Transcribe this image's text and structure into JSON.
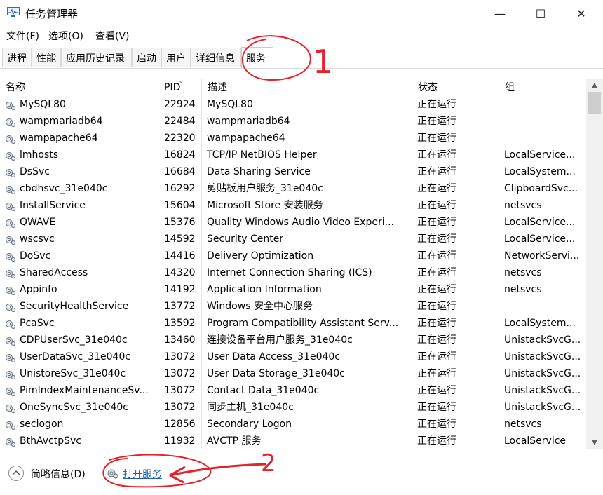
{
  "window": {
    "title": "任务管理器",
    "minimize": "—",
    "maximize": "☐",
    "close": "✕"
  },
  "menu": [
    "文件(F)",
    "选项(O)",
    "查看(V)"
  ],
  "tabs": [
    "进程",
    "性能",
    "应用历史记录",
    "启动",
    "用户",
    "详细信息",
    "服务"
  ],
  "active_tab": "服务",
  "columns": {
    "name": "名称",
    "pid": "PID",
    "desc": "描述",
    "status": "状态",
    "group": "组"
  },
  "rows": [
    {
      "name": "MySQL80",
      "pid": "22924",
      "desc": "MySQL80",
      "status": "正在运行",
      "group": ""
    },
    {
      "name": "wampmariadb64",
      "pid": "22484",
      "desc": "wampmariadb64",
      "status": "正在运行",
      "group": ""
    },
    {
      "name": "wampapache64",
      "pid": "22320",
      "desc": "wampapache64",
      "status": "正在运行",
      "group": ""
    },
    {
      "name": "lmhosts",
      "pid": "16824",
      "desc": "TCP/IP NetBIOS Helper",
      "status": "正在运行",
      "group": "LocalService..."
    },
    {
      "name": "DsSvc",
      "pid": "16684",
      "desc": "Data Sharing Service",
      "status": "正在运行",
      "group": "LocalSystem..."
    },
    {
      "name": "cbdhsvc_31e040c",
      "pid": "16292",
      "desc": "剪贴板用户服务_31e040c",
      "status": "正在运行",
      "group": "ClipboardSvc..."
    },
    {
      "name": "InstallService",
      "pid": "15604",
      "desc": "Microsoft Store 安装服务",
      "status": "正在运行",
      "group": "netsvcs"
    },
    {
      "name": "QWAVE",
      "pid": "15376",
      "desc": "Quality Windows Audio Video Experi...",
      "status": "正在运行",
      "group": "LocalService..."
    },
    {
      "name": "wscsvc",
      "pid": "14592",
      "desc": "Security Center",
      "status": "正在运行",
      "group": "LocalService..."
    },
    {
      "name": "DoSvc",
      "pid": "14416",
      "desc": "Delivery Optimization",
      "status": "正在运行",
      "group": "NetworkServi..."
    },
    {
      "name": "SharedAccess",
      "pid": "14320",
      "desc": "Internet Connection Sharing (ICS)",
      "status": "正在运行",
      "group": "netsvcs"
    },
    {
      "name": "Appinfo",
      "pid": "14192",
      "desc": "Application Information",
      "status": "正在运行",
      "group": "netsvcs"
    },
    {
      "name": "SecurityHealthService",
      "pid": "13772",
      "desc": "Windows 安全中心服务",
      "status": "正在运行",
      "group": ""
    },
    {
      "name": "PcaSvc",
      "pid": "13592",
      "desc": "Program Compatibility Assistant Serv...",
      "status": "正在运行",
      "group": "LocalSystem..."
    },
    {
      "name": "CDPUserSvc_31e040c",
      "pid": "13460",
      "desc": "连接设备平台用户服务_31e040c",
      "status": "正在运行",
      "group": "UnistackSvcG..."
    },
    {
      "name": "UserDataSvc_31e040c",
      "pid": "13072",
      "desc": "User Data Access_31e040c",
      "status": "正在运行",
      "group": "UnistackSvcG..."
    },
    {
      "name": "UnistoreSvc_31e040c",
      "pid": "13072",
      "desc": "User Data Storage_31e040c",
      "status": "正在运行",
      "group": "UnistackSvcG..."
    },
    {
      "name": "PimIndexMaintenanceSv...",
      "pid": "13072",
      "desc": "Contact Data_31e040c",
      "status": "正在运行",
      "group": "UnistackSvcG..."
    },
    {
      "name": "OneSyncSvc_31e040c",
      "pid": "13072",
      "desc": "同步主机_31e040c",
      "status": "正在运行",
      "group": "UnistackSvcG..."
    },
    {
      "name": "seclogon",
      "pid": "12856",
      "desc": "Secondary Logon",
      "status": "正在运行",
      "group": "netsvcs"
    },
    {
      "name": "BthAvctpSvc",
      "pid": "11932",
      "desc": "AVCTP 服务",
      "status": "正在运行",
      "group": "LocalService"
    }
  ],
  "footer": {
    "collapse_label": "简略信息(D)",
    "open_services": "打开服务"
  },
  "annotations": {
    "mark1": "1",
    "mark2": "2",
    "color": "#e8202a"
  },
  "icons": {
    "app": "task-manager-icon",
    "row": "gear-icon",
    "collapse": "chevron-up-icon"
  }
}
